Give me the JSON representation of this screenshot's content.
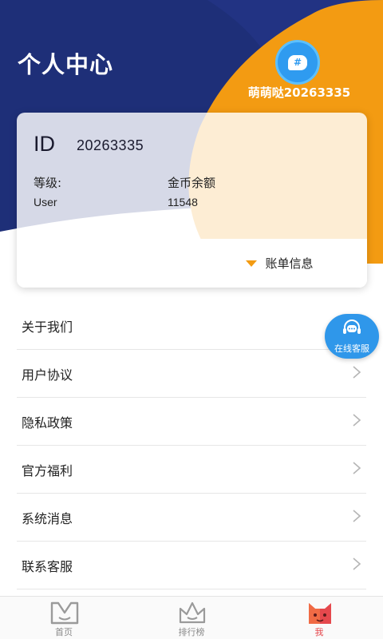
{
  "colors": {
    "navy": "#1e2f78",
    "orange": "#f39b12",
    "accent_blue": "#2f97ea",
    "active_tab": "#e5484d"
  },
  "header": {
    "title": "个人中心",
    "avatar_icon": "chat-bubble-hash-icon",
    "avatar_glyph": "#",
    "username": "萌萌哒20263335"
  },
  "card": {
    "id_label": "ID",
    "id_value": "20263335",
    "level_label": "等级:",
    "level_value": "User",
    "coin_label": "金币余额",
    "coin_value": "11548",
    "bill_label": "账单信息"
  },
  "menu": {
    "items": [
      {
        "label": "关于我们"
      },
      {
        "label": "用户协议"
      },
      {
        "label": "隐私政策"
      },
      {
        "label": "官方福利"
      },
      {
        "label": "系统消息"
      },
      {
        "label": "联系客服"
      }
    ]
  },
  "float_service": {
    "label": "在线客服",
    "icon": "headset-chat-icon"
  },
  "tabbar": {
    "tabs": [
      {
        "label": "首页",
        "icon": "home-m-icon",
        "active": false
      },
      {
        "label": "排行榜",
        "icon": "crown-icon",
        "active": false
      },
      {
        "label": "我",
        "icon": "cat-face-icon",
        "active": true
      }
    ]
  }
}
